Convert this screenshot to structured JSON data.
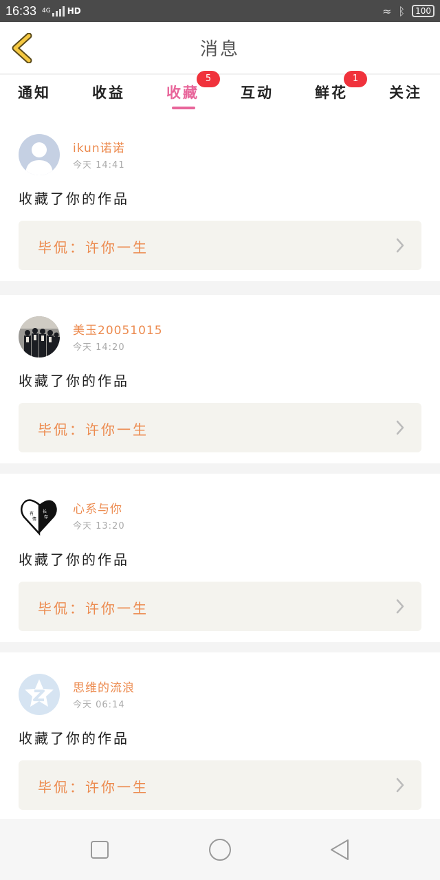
{
  "status_bar": {
    "time": "16:33",
    "network": "4G",
    "hd": "HD",
    "battery": "100"
  },
  "header": {
    "title": "消息"
  },
  "tabs": [
    {
      "label": "通知"
    },
    {
      "label": "收益"
    },
    {
      "label": "收藏",
      "active": true,
      "badge": "5"
    },
    {
      "label": "互动"
    },
    {
      "label": "鲜花",
      "badge": "1"
    },
    {
      "label": "关注"
    }
  ],
  "messages": [
    {
      "username": "ikun诺诺",
      "time": "今天 14:41",
      "action": "收藏了你的作品",
      "work_title": "毕侃：许你一生",
      "avatar": "default-person-avatar"
    },
    {
      "username": "美玉20051015",
      "time": "今天 14:20",
      "action": "收藏了你的作品",
      "work_title": "毕侃：许你一生",
      "avatar": "group-photo-avatar"
    },
    {
      "username": "心系与你",
      "time": "今天 13:20",
      "action": "收藏了你的作品",
      "work_title": "毕侃：许你一生",
      "avatar": "heart-avatar"
    },
    {
      "username": "思维的流浪",
      "time": "今天 06:14",
      "action": "收藏了你的作品",
      "work_title": "毕侃：许你一生",
      "avatar": "qzone-avatar"
    }
  ],
  "colors": {
    "accent_pink": "#e8659a",
    "username_orange": "#ec8a4e",
    "badge_red": "#f0323c",
    "back_yellow": "#f5c842"
  },
  "nav_icons": [
    "recent-apps-icon",
    "home-icon",
    "back-icon"
  ]
}
